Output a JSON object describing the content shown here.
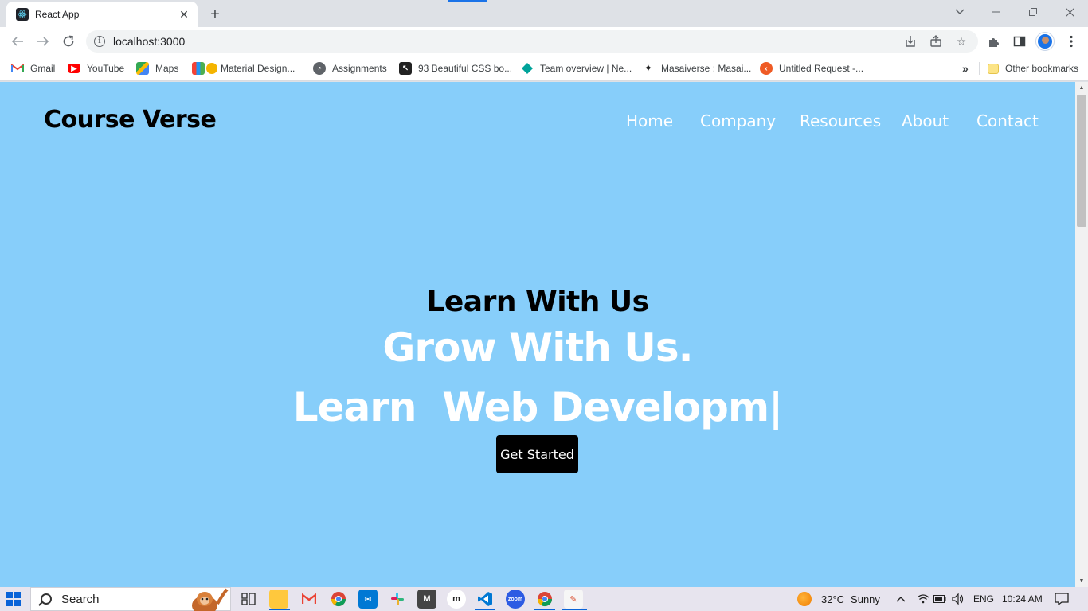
{
  "browser": {
    "tab_title": "React App",
    "url": "localhost:3000",
    "bookmarks": [
      {
        "label": "Gmail",
        "icon": "gmail-icon"
      },
      {
        "label": "YouTube",
        "icon": "youtube-icon"
      },
      {
        "label": "Maps",
        "icon": "maps-icon"
      },
      {
        "label": "Material Design...",
        "icon": "material-design-icon"
      },
      {
        "label": "Assignments",
        "icon": "assignments-icon"
      },
      {
        "label": "93 Beautiful CSS bo...",
        "icon": "css-icon"
      },
      {
        "label": "Team overview | Ne...",
        "icon": "team-icon"
      },
      {
        "label": "Masaiverse : Masai...",
        "icon": "masai-icon"
      },
      {
        "label": "Untitled Request -...",
        "icon": "postman-icon"
      }
    ],
    "overflow_label": "»",
    "other_bookmarks": "Other bookmarks"
  },
  "site": {
    "brand": "Course Verse",
    "nav": [
      "Home",
      "Company",
      "Resources",
      "About",
      "Contact"
    ],
    "hero_sub": "Learn With Us",
    "hero_main": "Grow With Us.",
    "hero_typed": "Learn  Web Developm|",
    "cta": "Get Started",
    "colors": {
      "background": "#87cefa",
      "button": "#000000",
      "accent_text": "#ffffff"
    }
  },
  "taskbar": {
    "search_label": "Search",
    "weather_temp": "32°C",
    "weather_desc": "Sunny",
    "language": "ENG",
    "time": "10:24 AM"
  }
}
